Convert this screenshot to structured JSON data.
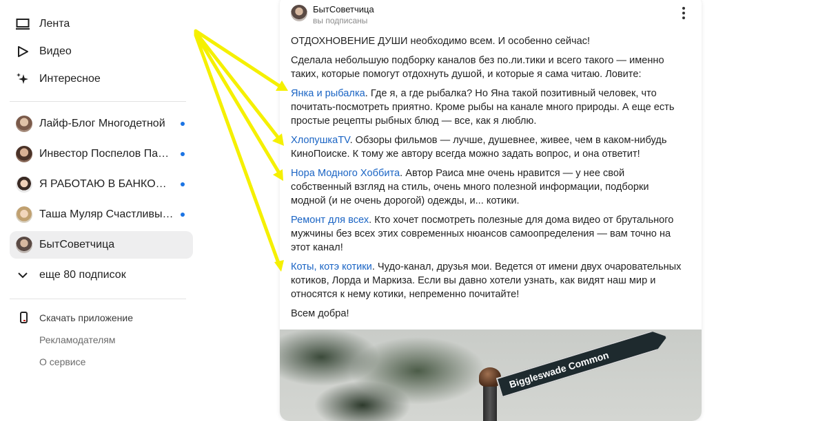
{
  "sidebar": {
    "nav": [
      {
        "label": "Лента",
        "icon": "feed-icon"
      },
      {
        "label": "Видео",
        "icon": "play-icon"
      },
      {
        "label": "Интересное",
        "icon": "sparkle-icon"
      }
    ],
    "subscriptions": [
      {
        "name": "Лайф-Блог Многодетной",
        "unread": true,
        "avatar_color": "#7a5a4a"
      },
      {
        "name": "Инвестор Поспелов Павел",
        "unread": true,
        "avatar_color": "#6b4a3a"
      },
      {
        "name": "Я РАБОТАЮ В БАНКОМАТЕ",
        "unread": true,
        "avatar_color": "#c9a890"
      },
      {
        "name": "Таша Муляр Счастливые дети",
        "unread": true,
        "avatar_color": "#b8a078"
      },
      {
        "name": "БытСоветчица",
        "unread": false,
        "active": true,
        "avatar_color": "#5a4a44"
      }
    ],
    "more_label": "еще 80 подписок",
    "footer": {
      "download": "Скачать приложение",
      "advertisers": "Рекламодателям",
      "about": "О сервисе"
    }
  },
  "post": {
    "channel": "БытСоветчица",
    "subscribed": "вы подписаны",
    "intro1": "ОТДОХНОВЕНИЕ ДУШИ необходимо всем. И особенно сейчас!",
    "intro2": "Сделала небольшую подборку каналов без по.ли.тики и всего такого — именно таких, которые помогут отдохнуть душой, и которые я сама читаю. Ловите:",
    "items": [
      {
        "link": "Янка и рыбалка",
        "text": ". Где я, а где рыбалка? Но Яна такой позитивный человек, что почитать-посмотреть приятно. Кроме рыбы на канале много природы. А еще есть простые рецепты рыбных блюд — все, как я люблю."
      },
      {
        "link": "ХлопушкаTV",
        "text": ". Обзоры фильмов — лучше, душевнее, живее, чем в каком-нибудь КиноПоиске. К тому же автору всегда можно задать вопрос, и она ответит!"
      },
      {
        "link": "Нора Модного Хоббита",
        "text": ". Автор Раиса мне очень нравится — у нее свой собственный взгляд на стиль, очень много полезной информации, подборки модной (и не очень дорогой) одежды, и... котики."
      },
      {
        "link": "Ремонт для всех",
        "text": ". Кто хочет посмотреть полезные для дома видео от брутального мужчины без всех этих современных нюансов самоопределения — вам точно на этот канал!"
      },
      {
        "link": "Коты, котэ котики",
        "text": ". Чудо-канал, друзья мои. Ведется от имени двух очаровательных котиков, Лорда и Маркиза. Если вы давно хотели узнать, как видят наш мир и относятся к нему котики, непременно почитайте!"
      }
    ],
    "outro": "Всем добра!",
    "photo_sign": "Biggleswade Common"
  },
  "colors": {
    "link": "#1a64c4",
    "unread_dot": "#1b74e4",
    "arrow": "#f5f000",
    "active_bg": "#eeeeef"
  }
}
